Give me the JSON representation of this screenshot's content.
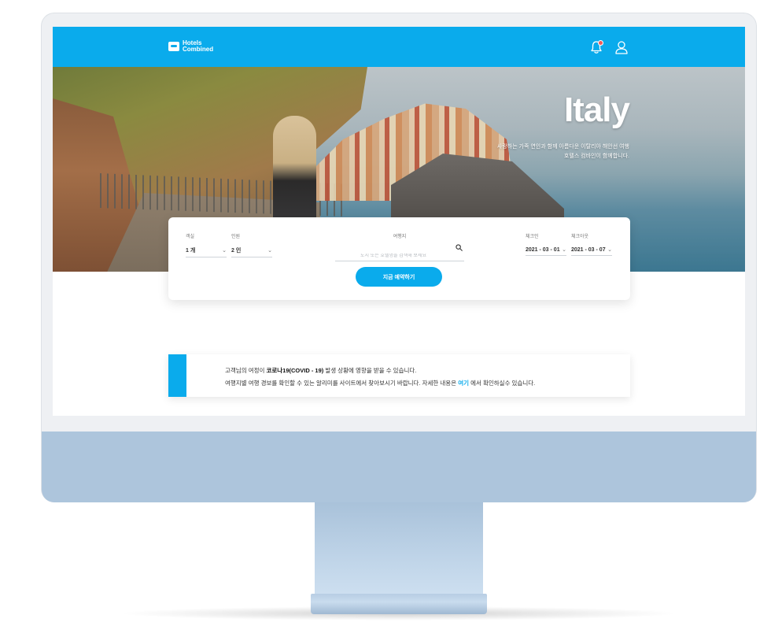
{
  "brand": {
    "logo_line1": "Hotels",
    "logo_line2": "Combined"
  },
  "header": {
    "notification_count": "1"
  },
  "hero": {
    "title": "Italy",
    "subtitle_line1": "사랑하는 가족 연인과 함께 아름다운 이탈리아 해안선 여행",
    "subtitle_line2": "호텔스 컴바인이 함께합니다."
  },
  "search": {
    "rooms": {
      "label": "객실",
      "value": "1 개"
    },
    "guests": {
      "label": "인원",
      "value": "2 인"
    },
    "destination": {
      "label": "여행지",
      "placeholder": "도시 또는 호텔명을 검색해 보세요"
    },
    "checkin": {
      "label": "체크인",
      "value": "2021 - 03 - 01"
    },
    "checkout": {
      "label": "체크아웃",
      "value": "2021 - 03 - 07"
    },
    "book_label": "지금 예약하기"
  },
  "notice": {
    "line1_prefix": "고객님의 여정이 ",
    "line1_bold": "코로나19(COVID - 19)",
    "line1_suffix": " 발생 상황에 영향을 받을 수 있습니다.",
    "line2_prefix": "여행지별 여행 경보를 확인할 수 있는 알리미를 사이트에서 찾아보시기 바랍니다. 자세한 내용은 ",
    "line2_link": "여기",
    "line2_suffix": " 에서 확인하실수 있습니다."
  },
  "colors": {
    "accent": "#0aabec",
    "badge": "#f05a5a",
    "monitor_chin": "#adc5dc"
  }
}
